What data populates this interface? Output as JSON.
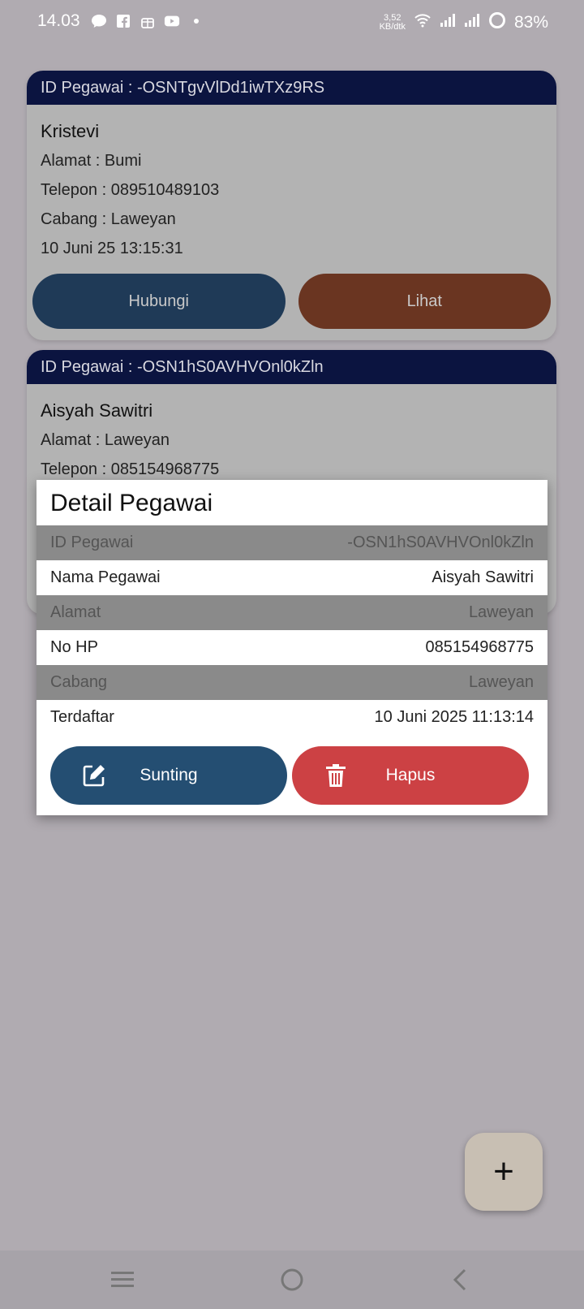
{
  "status_bar": {
    "time": "14.03",
    "speed": "3,52",
    "speed_unit": "KB/dtk",
    "battery": "83%"
  },
  "cards": [
    {
      "header": "ID Pegawai : -OSNTgvVlDd1iwTXz9RS",
      "name": "Kristevi",
      "address": "Alamat : Bumi",
      "phone": "Telepon : 089510489103",
      "branch": "Cabang : Laweyan",
      "date": "10 Juni 25 13:15:31",
      "contact_label": "Hubungi",
      "view_label": "Lihat"
    },
    {
      "header": "ID Pegawai : -OSN1hS0AVHVOnl0kZln",
      "name": "Aisyah Sawitri",
      "address": "Alamat : Laweyan",
      "phone": "Telepon : 085154968775"
    }
  ],
  "dialog": {
    "title": "Detail Pegawai",
    "rows": [
      {
        "label": "ID Pegawai",
        "value": "-OSN1hS0AVHVOnl0kZln"
      },
      {
        "label": "Nama Pegawai",
        "value": "Aisyah Sawitri"
      },
      {
        "label": "Alamat",
        "value": "Laweyan"
      },
      {
        "label": "No HP",
        "value": "085154968775"
      },
      {
        "label": "Cabang",
        "value": "Laweyan"
      },
      {
        "label": "Terdaftar",
        "value": "10 Juni 2025 11:13:14"
      }
    ],
    "edit_label": "Sunting",
    "delete_label": "Hapus"
  },
  "fab": {
    "icon": "plus-icon",
    "label": "+"
  },
  "colors": {
    "background": "#b0abb1",
    "card_header": "#0b1440",
    "contact_button": "#1f3a57",
    "view_button": "#6a3521",
    "edit_button": "#244e72",
    "delete_button": "#cc4144",
    "fab": "#c8bfb3"
  }
}
